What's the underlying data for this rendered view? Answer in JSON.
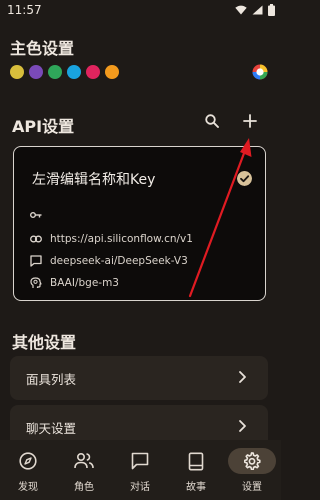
{
  "status_bar": {
    "time": "11:57",
    "icons": [
      "wifi-icon",
      "signal-icon",
      "battery-icon"
    ]
  },
  "theme": {
    "title": "主色设置",
    "swatches": [
      "#D8BE3C",
      "#7A4AB8",
      "#2FA75A",
      "#19A3DF",
      "#E0245E",
      "#F39A1D"
    ],
    "palette_icon": "color-palette-icon"
  },
  "api": {
    "title": "API设置",
    "search_icon": "search-icon",
    "add_icon": "plus-icon",
    "card": {
      "title": "左滑编辑名称和Key",
      "selected": true,
      "rows": [
        {
          "icon": "key-icon",
          "value": ""
        },
        {
          "icon": "link-icon",
          "value": "https://api.siliconflow.cn/v1"
        },
        {
          "icon": "chat-bubble-icon",
          "value": "deepseek-ai/DeepSeek-V3"
        },
        {
          "icon": "brain-icon",
          "value": "BAAI/bge-m3"
        }
      ]
    }
  },
  "other": {
    "title": "其他设置",
    "items": [
      {
        "label": "面具列表"
      },
      {
        "label": "聊天设置"
      }
    ]
  },
  "bottom_nav": {
    "items": [
      {
        "label": "发现",
        "icon": "compass-icon"
      },
      {
        "label": "角色",
        "icon": "people-icon"
      },
      {
        "label": "对话",
        "icon": "chat-icon"
      },
      {
        "label": "故事",
        "icon": "book-icon"
      },
      {
        "label": "设置",
        "icon": "gear-icon"
      }
    ],
    "active": "设置"
  },
  "colors": {
    "background": "#1E1A17",
    "card_border": "#D9D4CE",
    "annotation_arrow": "#E01B22",
    "nav_active_pill": "#4C4237"
  }
}
